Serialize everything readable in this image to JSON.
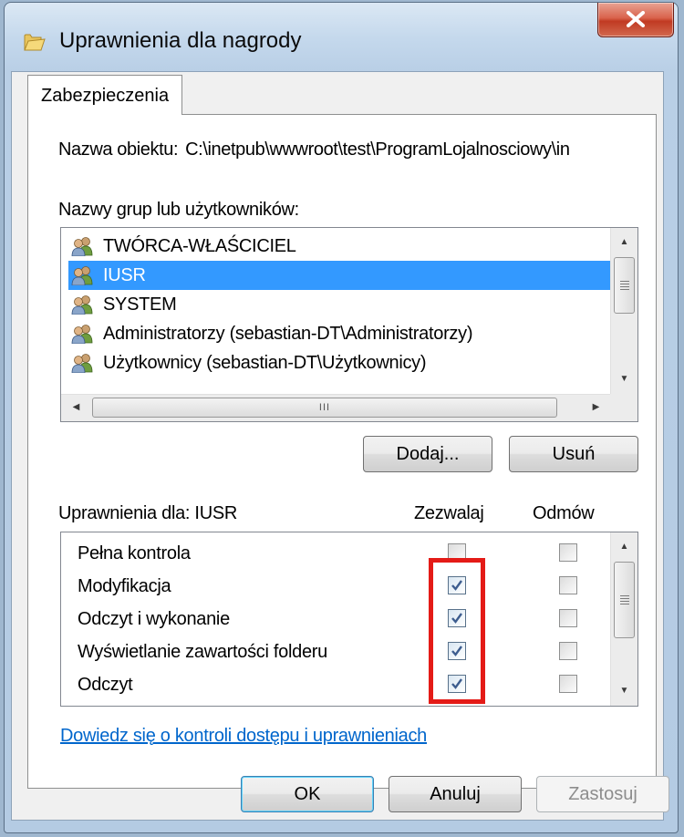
{
  "window": {
    "title": "Uprawnienia dla nagrody",
    "close_label": "X"
  },
  "tabs": [
    {
      "label": "Zabezpieczenia",
      "selected": true
    }
  ],
  "object": {
    "label": "Nazwa obiektu:",
    "path": "C:\\inetpub\\wwwroot\\test\\ProgramLojalnosciowy\\in"
  },
  "groups": {
    "label": "Nazwy grup lub użytkowników:",
    "selected_index": 1,
    "items": [
      {
        "name": "TWÓRCA-WŁAŚCICIEL",
        "icon": "users-icon"
      },
      {
        "name": "IUSR",
        "icon": "users-icon"
      },
      {
        "name": "SYSTEM",
        "icon": "users-icon"
      },
      {
        "name": "Administratorzy (sebastian-DT\\Administratorzy)",
        "icon": "users-icon"
      },
      {
        "name": "Użytkownicy (sebastian-DT\\Użytkownicy)",
        "icon": "users-icon"
      }
    ],
    "hscroll_grip": "III"
  },
  "buttons": {
    "add": "Dodaj...",
    "remove": "Usuń",
    "ok": "OK",
    "cancel": "Anuluj",
    "apply": "Zastosuj"
  },
  "permissions": {
    "label": "Uprawnienia dla: IUSR",
    "allow_header": "Zezwalaj",
    "deny_header": "Odmów",
    "rows": [
      {
        "name": "Pełna kontrola",
        "allow": false,
        "deny": false
      },
      {
        "name": "Modyfikacja",
        "allow": true,
        "deny": false
      },
      {
        "name": "Odczyt i wykonanie",
        "allow": true,
        "deny": false
      },
      {
        "name": "Wyświetlanie zawartości folderu",
        "allow": true,
        "deny": false
      },
      {
        "name": "Odczyt",
        "allow": true,
        "deny": false
      }
    ]
  },
  "link": "Dowiedz się o kontroli dostępu i uprawnieniach",
  "colors": {
    "selection": "#3399ff",
    "highlight_box": "#e41b17",
    "link": "#0066cc"
  }
}
